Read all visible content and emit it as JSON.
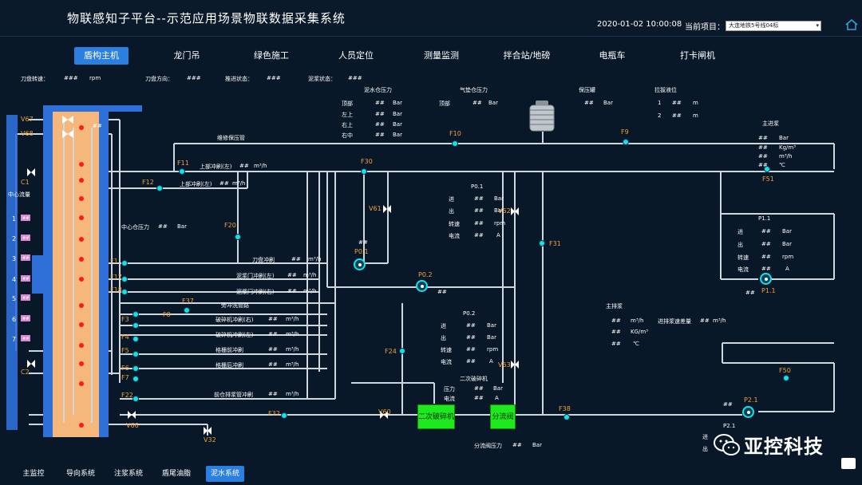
{
  "header": {
    "title": "物联感知子平台--示范应用场景物联数据采集系统",
    "datetime": "2020-01-02 10:00:08",
    "project_label": "当前项目：",
    "project_value": "大连地铁5号线04标"
  },
  "nav": {
    "tabs": [
      "盾构主机",
      "龙门吊",
      "绿色施工",
      "人员定位",
      "测量监测",
      "拌合站/地磅",
      "电瓶车",
      "打卡闸机"
    ],
    "active_index": 0
  },
  "bottom_nav": {
    "items": [
      "主监控",
      "导向系统",
      "注浆系统",
      "盾尾油脂",
      "泥水系统"
    ],
    "active_index": 4
  },
  "status_bar": {
    "cutter_speed_label": "刀盘转速：",
    "cutter_speed_value": "###",
    "cutter_speed_unit": "rpm",
    "cutter_dir_label": "刀盘方向：",
    "cutter_dir_value": "###",
    "advance_label": "推进状态：",
    "advance_value": "###",
    "slurry_label": "泥浆状态：",
    "slurry_value": "###"
  },
  "slurry_pressure": {
    "title": "泥水仓压力",
    "rows": [
      {
        "label": "顶部",
        "value": "##",
        "unit": "Bar"
      },
      {
        "label": "左上",
        "value": "##",
        "unit": "Bar"
      },
      {
        "label": "右上",
        "value": "##",
        "unit": "Bar"
      },
      {
        "label": "右中",
        "value": "##",
        "unit": "Bar"
      }
    ]
  },
  "air_pressure": {
    "title": "气垫仓压力",
    "row_label": "顶部",
    "value": "##",
    "unit": "Bar"
  },
  "tank": {
    "title": "保压罐",
    "value": "##",
    "unit": "Bar"
  },
  "level": {
    "title": "拉拔液位",
    "rows": [
      {
        "label": "1",
        "value": "##",
        "unit": "m"
      },
      {
        "label": "2",
        "value": "##",
        "unit": "m"
      }
    ]
  },
  "main_inlet": {
    "title": "主进浆",
    "rows": [
      {
        "value": "##",
        "unit": "Bar"
      },
      {
        "value": "##",
        "unit": "Kg/m³"
      },
      {
        "value": "##",
        "unit": "m³/h"
      },
      {
        "value": "##",
        "unit": "℃"
      }
    ]
  },
  "main_outlet": {
    "title": "主排浆",
    "rows": [
      {
        "value": "##",
        "unit": "m³/h"
      },
      {
        "value": "##",
        "unit": "KG/m³"
      },
      {
        "value": "##",
        "unit": "℃"
      }
    ],
    "extra_label": "进排浆速差量",
    "extra_value": "##",
    "extra_unit": "m³/h"
  },
  "p01_panel": {
    "title": "P0.1",
    "rows": [
      {
        "label": "进",
        "value": "##",
        "unit": "Bar"
      },
      {
        "label": "出",
        "value": "##",
        "unit": "Bar"
      },
      {
        "label": "转速",
        "value": "##",
        "unit": "rpm"
      },
      {
        "label": "电流",
        "value": "##",
        "unit": "A"
      }
    ]
  },
  "p02_panel": {
    "title": "P0.2",
    "rows": [
      {
        "label": "进",
        "value": "##",
        "unit": "Bar"
      },
      {
        "label": "出",
        "value": "##",
        "unit": "Bar"
      },
      {
        "label": "转速",
        "value": "##",
        "unit": "rpm"
      },
      {
        "label": "电流",
        "value": "##",
        "unit": "A"
      }
    ]
  },
  "p11_panel": {
    "title": "P1.1",
    "rows": [
      {
        "label": "进",
        "value": "##",
        "unit": "Bar"
      },
      {
        "label": "出",
        "value": "##",
        "unit": "Bar"
      },
      {
        "label": "转速",
        "value": "##",
        "unit": "rpm"
      },
      {
        "label": "电流",
        "value": "##",
        "unit": "A"
      }
    ],
    "below_value": "##"
  },
  "p21_panel": {
    "title": "P2.1",
    "value": "##",
    "in_label": "进",
    "out_label": "出"
  },
  "crusher": {
    "title": "二次破碎机",
    "rows": [
      {
        "label": "压力",
        "value": "##",
        "unit": "Bar"
      },
      {
        "label": "电流",
        "value": "##",
        "unit": "A"
      }
    ]
  },
  "splitter_pressure": {
    "label": "分流阀压力",
    "value": "##",
    "unit": "Bar"
  },
  "center_pressure": {
    "label": "中心仓压力",
    "value": "##",
    "unit": "Bar"
  },
  "lines": {
    "maintain_pipe": "维修保压管",
    "upper_left": {
      "label": "上部冲刷(左)",
      "value": "##",
      "unit": "m³/h"
    },
    "upper_left2": {
      "label": "上部冲刷(左)",
      "value": "##",
      "unit": "m³/h"
    },
    "cutter_flush": {
      "label": "刀盘冲刷",
      "value": "##",
      "unit": "m³/h"
    },
    "gate_left": {
      "label": "泥浆门冲刷(左)",
      "value": "##",
      "unit": "m³/h"
    },
    "gate_right": {
      "label": "泥浆门冲刷(右)",
      "value": "##",
      "unit": "m³/h"
    },
    "flush_pipe": "旁冲洗管路",
    "crusher_right": {
      "label": "破碎机冲刷(右)",
      "value": "##",
      "unit": "m³/h"
    },
    "crusher_left": {
      "label": "破碎机冲刷(左)",
      "value": "##",
      "unit": "m³/h"
    },
    "grid_front": {
      "label": "格栅前冲刷",
      "value": "##",
      "unit": "m³/h"
    },
    "grid_back": {
      "label": "格栅后冲刷",
      "value": "##",
      "unit": "m³/h"
    },
    "front_drain": {
      "label": "前仓排浆管冲刷",
      "value": "##",
      "unit": "m³/h"
    }
  },
  "shield": {
    "center_flow_label": "中心流量",
    "ports": [
      "1",
      "2",
      "3",
      "4",
      "5",
      "6",
      "7"
    ],
    "port_value": "##",
    "v67_value": "##"
  },
  "tags": {
    "V67": "V67",
    "V68": "V68",
    "C1": "C1",
    "C2": "C2",
    "F1": "F1",
    "F3": "F3",
    "F4": "F4",
    "F5": "F5",
    "F6": "F6",
    "F7": "F7",
    "F8": "F8",
    "F9": "F9",
    "F10": "F10",
    "F11": "F11",
    "F12": "F12",
    "F17": "F17",
    "F18": "F18",
    "F20": "F20",
    "F22": "F22",
    "F24": "F24",
    "F30": "F30",
    "F31": "F31",
    "F32": "F32",
    "F37": "F37",
    "F38": "F38",
    "F50": "F50",
    "F51": "F51",
    "V60": "V60",
    "V61": "V61",
    "V62": "V62",
    "V63": "V63",
    "V66": "V66",
    "V32": "V32",
    "P01": "P0.1",
    "P02": "P0.2",
    "P11": "P1.1",
    "P21": "P2.1"
  },
  "p01_pump_value": "##",
  "p02_pump_value": "##",
  "boxes": {
    "crusher": "二次破碎机",
    "splitter": "分流阀"
  },
  "watermark": "亚控科技",
  "colors": {
    "accent": "#2a7fe0",
    "sensor": "#16e0e8",
    "tag": "#f2a23a",
    "alarm": "#ff1a1a",
    "box": "#1ee81e",
    "shield": "#f6b77c",
    "shield_frame": "#2f6fd8"
  }
}
